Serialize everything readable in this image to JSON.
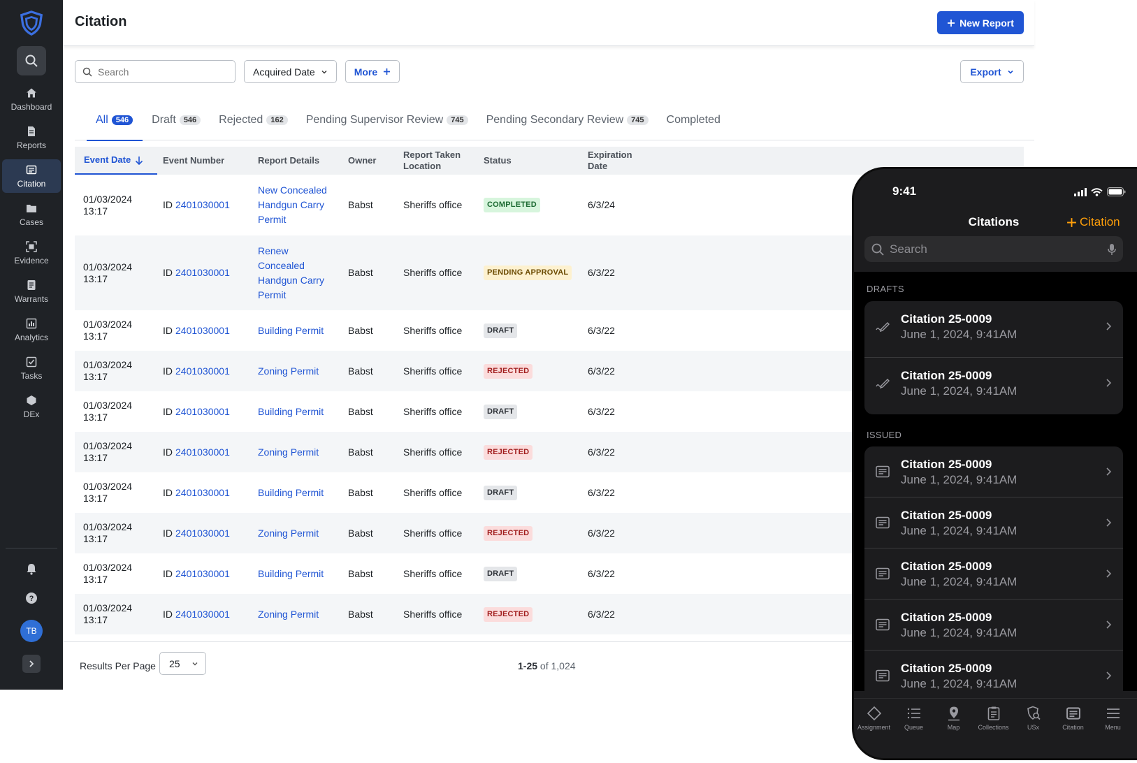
{
  "sidebar": {
    "nav": [
      {
        "label": "Dashboard",
        "icon": "home-icon"
      },
      {
        "label": "Reports",
        "icon": "document-icon"
      },
      {
        "label": "Citation",
        "icon": "citation-icon"
      },
      {
        "label": "Cases",
        "icon": "folder-icon"
      },
      {
        "label": "Evidence",
        "icon": "evidence-icon"
      },
      {
        "label": "Warrants",
        "icon": "warrant-icon"
      },
      {
        "label": "Analytics",
        "icon": "chart-icon"
      },
      {
        "label": "Tasks",
        "icon": "checkbox-icon"
      },
      {
        "label": "DEx",
        "icon": "hexagon-icon"
      }
    ],
    "active_index": 2,
    "avatar_initials": "TB"
  },
  "header": {
    "title": "Citation",
    "new_report_label": "New Report"
  },
  "filters": {
    "search_placeholder": "Search",
    "date_filter_label": "Acquired Date",
    "more_label": "More",
    "export_label": "Export"
  },
  "tabs": [
    {
      "label": "All",
      "count": "546"
    },
    {
      "label": "Draft",
      "count": "546"
    },
    {
      "label": "Rejected",
      "count": "162"
    },
    {
      "label": "Pending Supervisor Review",
      "count": "745"
    },
    {
      "label": "Pending Secondary Review",
      "count": "745"
    },
    {
      "label": "Completed",
      "count": ""
    }
  ],
  "table": {
    "columns": [
      "Event Date",
      "Event Number",
      "Report Details",
      "Owner",
      "Report Taken Location",
      "Status",
      "Expiration Date"
    ],
    "id_prefix": "ID",
    "rows": [
      {
        "date": "01/03/2024",
        "time": "13:17",
        "event_number": "2401030001",
        "details": "New Concealed Handgun Carry Permit",
        "owner": "Babst",
        "location": "Sheriffs office",
        "status": "COMPLETED",
        "status_kind": "completed",
        "expiration": "6/3/24"
      },
      {
        "date": "01/03/2024",
        "time": "13:17",
        "event_number": "2401030001",
        "details": "Renew Concealed Handgun Carry Permit",
        "owner": "Babst",
        "location": "Sheriffs office",
        "status": "PENDING APPROVAL",
        "status_kind": "pending",
        "expiration": "6/3/22"
      },
      {
        "date": "01/03/2024",
        "time": "13:17",
        "event_number": "2401030001",
        "details": "Building Permit",
        "owner": "Babst",
        "location": "Sheriffs office",
        "status": "DRAFT",
        "status_kind": "draft",
        "expiration": "6/3/22"
      },
      {
        "date": "01/03/2024",
        "time": "13:17",
        "event_number": "2401030001",
        "details": "Zoning Permit",
        "owner": "Babst",
        "location": "Sheriffs office",
        "status": "REJECTED",
        "status_kind": "rejected",
        "expiration": "6/3/22"
      },
      {
        "date": "01/03/2024",
        "time": "13:17",
        "event_number": "2401030001",
        "details": "Building Permit",
        "owner": "Babst",
        "location": "Sheriffs office",
        "status": "DRAFT",
        "status_kind": "draft",
        "expiration": "6/3/22"
      },
      {
        "date": "01/03/2024",
        "time": "13:17",
        "event_number": "2401030001",
        "details": "Zoning Permit",
        "owner": "Babst",
        "location": "Sheriffs office",
        "status": "REJECTED",
        "status_kind": "rejected",
        "expiration": "6/3/22"
      },
      {
        "date": "01/03/2024",
        "time": "13:17",
        "event_number": "2401030001",
        "details": "Building Permit",
        "owner": "Babst",
        "location": "Sheriffs office",
        "status": "DRAFT",
        "status_kind": "draft",
        "expiration": "6/3/22"
      },
      {
        "date": "01/03/2024",
        "time": "13:17",
        "event_number": "2401030001",
        "details": "Zoning Permit",
        "owner": "Babst",
        "location": "Sheriffs office",
        "status": "REJECTED",
        "status_kind": "rejected",
        "expiration": "6/3/22"
      },
      {
        "date": "01/03/2024",
        "time": "13:17",
        "event_number": "2401030001",
        "details": "Building Permit",
        "owner": "Babst",
        "location": "Sheriffs office",
        "status": "DRAFT",
        "status_kind": "draft",
        "expiration": "6/3/22"
      },
      {
        "date": "01/03/2024",
        "time": "13:17",
        "event_number": "2401030001",
        "details": "Zoning Permit",
        "owner": "Babst",
        "location": "Sheriffs office",
        "status": "REJECTED",
        "status_kind": "rejected",
        "expiration": "6/3/22"
      }
    ]
  },
  "pagination": {
    "results_per_page_label": "Results Per Page",
    "per_page_value": "25",
    "range": "1-25",
    "of_total": "of 1,024"
  },
  "phone": {
    "time": "9:41",
    "title": "Citations",
    "add_label": "Citation",
    "search_placeholder": "Search",
    "drafts_header": "DRAFTS",
    "issued_header": "ISSUED",
    "drafts": [
      {
        "title": "Citation 25-0009",
        "subtitle": "June 1, 2024, 9:41AM"
      },
      {
        "title": "Citation 25-0009",
        "subtitle": "June 1, 2024, 9:41AM"
      }
    ],
    "issued": [
      {
        "title": "Citation 25-0009",
        "subtitle": "June 1, 2024, 9:41AM"
      },
      {
        "title": "Citation 25-0009",
        "subtitle": "June 1, 2024, 9:41AM"
      },
      {
        "title": "Citation 25-0009",
        "subtitle": "June 1, 2024, 9:41AM"
      },
      {
        "title": "Citation 25-0009",
        "subtitle": "June 1, 2024, 9:41AM"
      },
      {
        "title": "Citation 25-0009",
        "subtitle": "June 1, 2024, 9:41AM"
      }
    ],
    "tabbar": [
      {
        "label": "Assignment",
        "icon": "diamond-icon"
      },
      {
        "label": "Queue",
        "icon": "list-icon"
      },
      {
        "label": "Map",
        "icon": "map-pin-icon"
      },
      {
        "label": "Collections",
        "icon": "clipboard-icon"
      },
      {
        "label": "USx",
        "icon": "badge-search-icon"
      },
      {
        "label": "Citation",
        "icon": "citation-icon"
      },
      {
        "label": "Menu",
        "icon": "menu-icon"
      }
    ]
  },
  "colors": {
    "accent": "#2055d4",
    "sidebar_bg": "#1f2226",
    "phone_accent": "#ff9f0a"
  }
}
